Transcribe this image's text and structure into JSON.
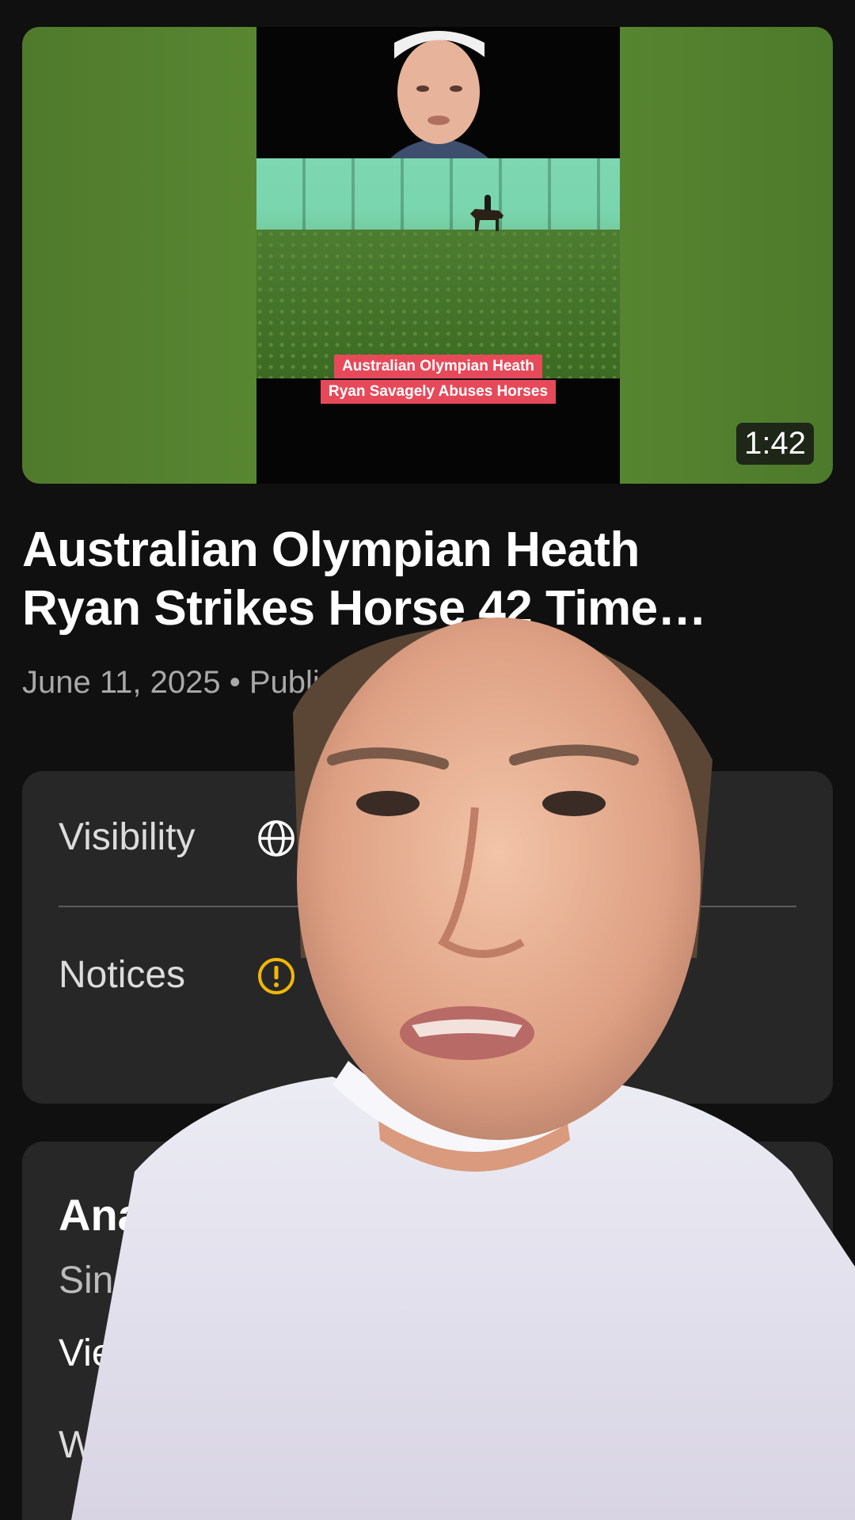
{
  "video": {
    "duration": "1:42",
    "thumbnail_caption": [
      "Australian Olympian Heath",
      "Ryan Savagely Abuses Horses"
    ],
    "title_line1": "Australian Olympian Heath",
    "title_line2": "Ryan Strikes Horse 42 Time…",
    "meta": "June 11, 2025 • Publi"
  },
  "details": {
    "visibility_label": "Visibility",
    "notices_label": "Notices"
  },
  "analytics": {
    "title": "Analytic",
    "subtitle": "Since p",
    "views_label": "View",
    "watch_label": "Wa"
  },
  "icons": {
    "visibility": "globe-icon",
    "notices": "warning-icon"
  },
  "colors": {
    "background": "#101010",
    "card": "#272727",
    "warning": "#f2b705",
    "thumb_green": "#5a8a32",
    "caption_bg": "#e64a5a"
  }
}
